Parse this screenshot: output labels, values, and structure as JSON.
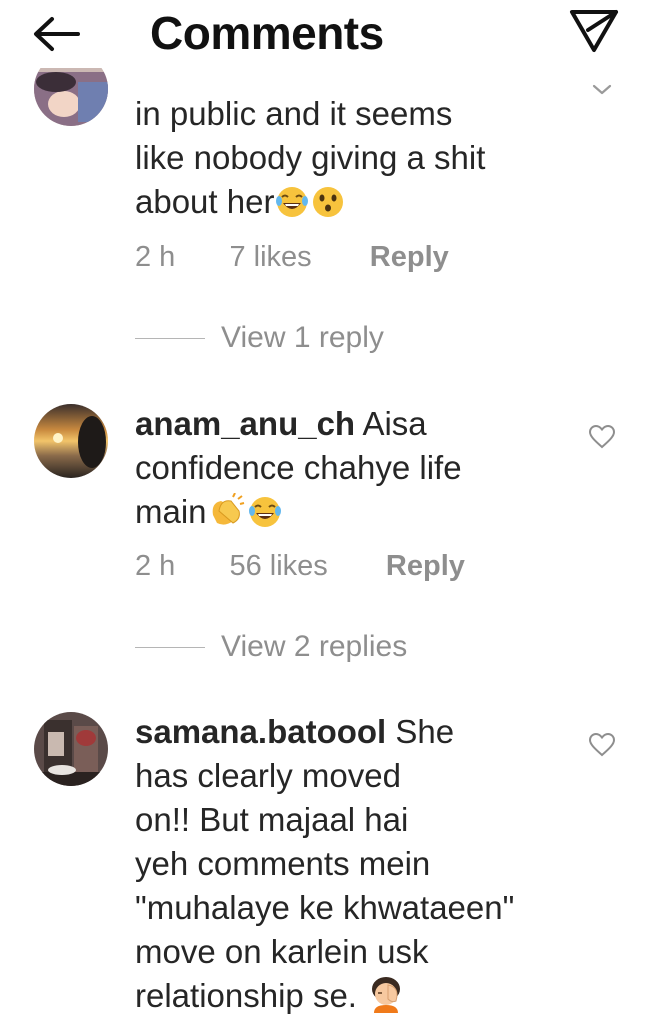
{
  "header": {
    "title": "Comments"
  },
  "comments": [
    {
      "username": "",
      "lines": [
        "in public and it seems",
        "like nobody  giving a shit",
        "about her"
      ],
      "time": "2 h",
      "likes": "7 likes",
      "reply_label": "Reply",
      "view_replies": "View 1 reply"
    },
    {
      "username": "anam_anu_ch",
      "lines": [
        " Aisa",
        "confidence chahye life",
        "main"
      ],
      "time": "2 h",
      "likes": "56 likes",
      "reply_label": "Reply",
      "view_replies": "View 2 replies"
    },
    {
      "username": "samana.batoool",
      "lines": [
        " She",
        "has clearly moved",
        "on!! But majaal hai",
        "yeh comments mein",
        "\"muhalaye ke khwataeen\"",
        "move on karlein usk",
        "relationship se."
      ]
    }
  ],
  "colors": {
    "text": "#262626",
    "muted": "#8e8e8e",
    "divider": "#b5b5b5"
  },
  "icons": [
    "back-arrow-icon",
    "send-icon",
    "chevron-down-icon",
    "heart-icon",
    "joy-emoji",
    "astonished-emoji",
    "clapping-hands-emoji",
    "facepalm-emoji"
  ]
}
